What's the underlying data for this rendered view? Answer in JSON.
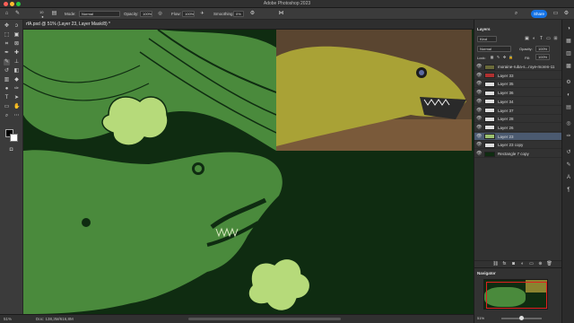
{
  "app": {
    "title": "Adobe Photoshop 2023"
  },
  "colors": {
    "canvas": "#0f2c11",
    "eel_green": "#4a8a3c",
    "flower": "#b6da7a",
    "accent": "#1473e6"
  },
  "options_bar": {
    "mode_label": "Mode:",
    "mode_value": "Normal",
    "opacity_label": "Opacity:",
    "opacity_value": "100%",
    "flow_label": "Flow:",
    "flow_value": "100%",
    "smoothing_label": "Smoothing:",
    "smoothing_value": "0%",
    "brush_size": "10",
    "share_label": "Share"
  },
  "document": {
    "tab_label": "rfA.psd @ 51% (Layer 23, Layer Mask/8) *"
  },
  "status": {
    "zoom": "51%",
    "doc_info": "Doc: 138,3M/616,8M"
  },
  "layers_panel": {
    "title": "Layers",
    "filter_kind": "Kind",
    "blend_mode": "Normal",
    "opacity_label": "Opacity:",
    "opacity_value": "100%",
    "lock_label": "Lock:",
    "fill_label": "Fill:",
    "fill_value": "100%",
    "layers": [
      {
        "name": "moraine-ruba-s...roye-moren-11",
        "thumb": "#6a6a3a"
      },
      {
        "name": "Layer 33",
        "thumb": "#b03030"
      },
      {
        "name": "Layer 35",
        "thumb": "#dddddd"
      },
      {
        "name": "Layer 36",
        "thumb": "#dddddd"
      },
      {
        "name": "Layer 34",
        "thumb": "#dddddd"
      },
      {
        "name": "Layer 37",
        "thumb": "#dddddd"
      },
      {
        "name": "Layer 28",
        "thumb": "#dddddd"
      },
      {
        "name": "Layer 26",
        "thumb": "#dddddd"
      },
      {
        "name": "Layer 23",
        "thumb": "#9ac070"
      },
      {
        "name": "Layer 23 copy",
        "thumb": "#dddddd"
      },
      {
        "name": "Rectangle 7 copy",
        "thumb": "#0f2c11"
      }
    ]
  },
  "navigator": {
    "title": "Navigator",
    "zoom": "51%"
  }
}
